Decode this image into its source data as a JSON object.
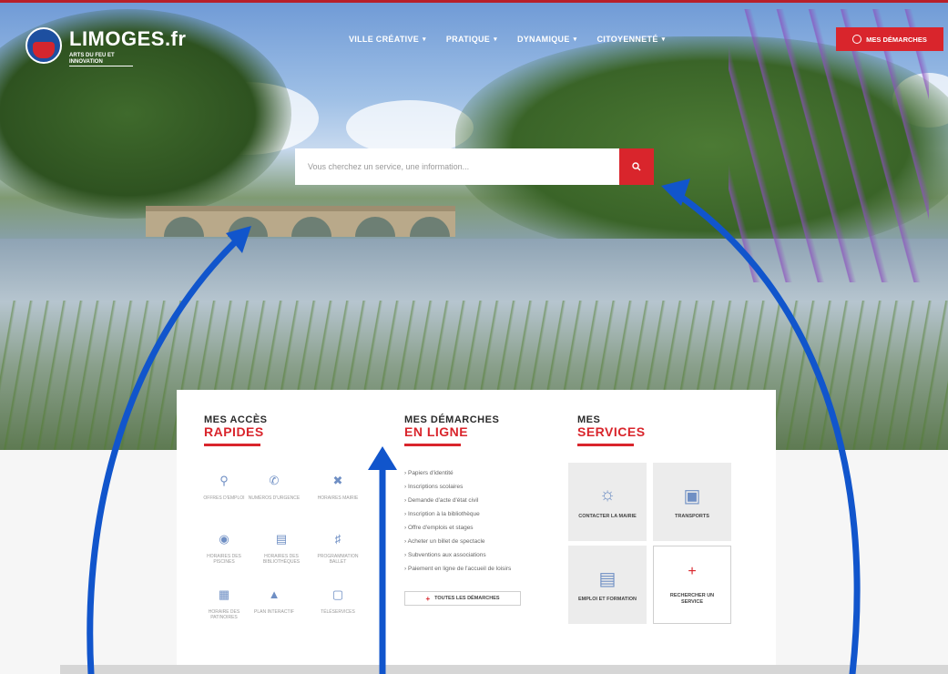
{
  "brand": {
    "name": "LIMOGES.fr",
    "tagline": "ARTS DU FEU ET INNOVATION",
    "colors": {
      "accent": "#d9252c",
      "icon_blue": "#6f8fc4",
      "arrow_blue": "#1155cc"
    }
  },
  "nav": {
    "items": [
      {
        "label": "VILLE CRÉATIVE",
        "icon": "chevron-down-icon"
      },
      {
        "label": "PRATIQUE",
        "icon": "chevron-down-icon"
      },
      {
        "label": "DYNAMIQUE",
        "icon": "chevron-down-icon"
      },
      {
        "label": "CITOYENNETÉ",
        "icon": "chevron-down-icon"
      }
    ],
    "cta_label": "MES DÉMARCHES",
    "cta_icon": "at-sign-icon"
  },
  "search": {
    "placeholder": "Vous cherchez un service, une information...",
    "icon": "search-icon"
  },
  "quick_access": {
    "title_line1": "MES ACCÈS",
    "title_line2": "RAPIDES",
    "items": [
      {
        "label": "OFFRES D'EMPLOI",
        "icon": "magnifier-icon"
      },
      {
        "label": "NUMÉROS D'URGENCE",
        "icon": "phone-icon"
      },
      {
        "label": "HORAIRES MAIRIE",
        "icon": "tools-icon"
      },
      {
        "label": "HORAIRES DES PISCINES",
        "icon": "globe-icon"
      },
      {
        "label": "HORAIRES DES BIBLIOTHÈQUES",
        "icon": "document-icon"
      },
      {
        "label": "PROGRAMMATION BALLET",
        "icon": "speaker-icon"
      },
      {
        "label": "HORAIRE DES PATINOIRES",
        "icon": "calendar-icon"
      },
      {
        "label": "PLAN INTERACTIF",
        "icon": "map-icon"
      },
      {
        "label": "TÉLÉSERVICES",
        "icon": "monitor-icon"
      }
    ]
  },
  "online_procedures": {
    "title_line1": "MES DÉMARCHES",
    "title_line2": "EN LIGNE",
    "items": [
      "Papiers d'identité",
      "Inscriptions scolaires",
      "Demande d'acte d'état civil",
      "Inscription à la bibliothèque",
      "Offre d'emplois et stages",
      "Acheter un billet de spectacle",
      "Subventions aux associations",
      "Paiement en ligne de l'accueil de loisirs"
    ],
    "all_label": "TOUTES LES DÉMARCHES"
  },
  "services": {
    "title_line1": "MES",
    "title_line2": "SERVICES",
    "tiles": [
      {
        "label": "CONTACTER LA MAIRIE",
        "icon": "lightbulb-icon"
      },
      {
        "label": "TRANSPORTS",
        "icon": "bus-icon"
      },
      {
        "label": "EMPLOI ET FORMATION",
        "icon": "laptop-icon"
      },
      {
        "label": "RECHERCHER UN SERVICE",
        "icon": "plus-icon"
      }
    ]
  }
}
